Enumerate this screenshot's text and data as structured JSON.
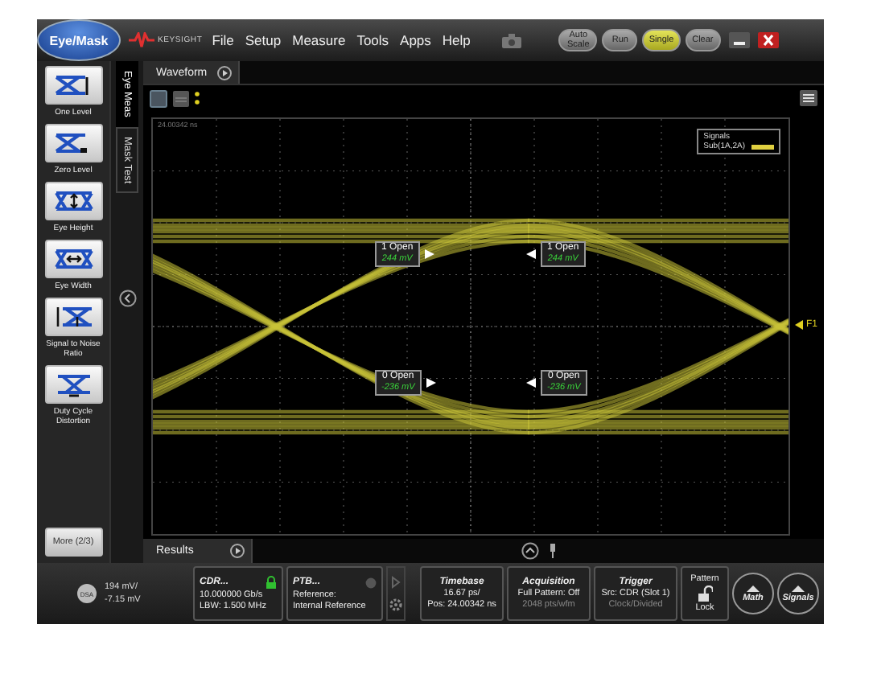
{
  "top_bar": {
    "mode_button": "Eye/Mask",
    "brand": "KEYSIGHT",
    "menu": [
      "File",
      "Setup",
      "Measure",
      "Tools",
      "Apps",
      "Help"
    ],
    "buttons": [
      {
        "label": "Auto Scale",
        "selected": false
      },
      {
        "label": "Run",
        "selected": false
      },
      {
        "label": "Single",
        "selected": true
      },
      {
        "label": "Clear",
        "selected": false
      }
    ]
  },
  "measurements": [
    {
      "label": "One Level",
      "kind": "one-level"
    },
    {
      "label": "Zero Level",
      "kind": "zero-level"
    },
    {
      "label": "Eye Height",
      "kind": "eye-height"
    },
    {
      "label": "Eye Width",
      "kind": "eye-width"
    },
    {
      "label": "Signal to Noise Ratio",
      "kind": "snr"
    },
    {
      "label": "Duty Cycle Distortion",
      "kind": "dcd"
    }
  ],
  "more_button": "More (2/3)",
  "side_tabs": [
    {
      "label": "Eye Meas",
      "selected": true
    },
    {
      "label": "Mask Test",
      "selected": false
    }
  ],
  "waveform": {
    "tab": "Waveform",
    "timestamp": "24.00342 ns",
    "legend": {
      "title": "Signals",
      "item": "Sub(1A,2A)"
    },
    "marker_label": "F1",
    "markers": [
      {
        "title": "1 Open",
        "value": "244 mV"
      },
      {
        "title": "1 Open",
        "value": "244 mV"
      },
      {
        "title": "0 Open",
        "value": "-236 mV"
      },
      {
        "title": "0 Open",
        "value": "-236 mV"
      }
    ]
  },
  "results_tab": "Results",
  "status_bar": {
    "channel": {
      "badge": "DSA",
      "scale": "194 mV/",
      "offset": "-7.15 mV"
    },
    "cdr": {
      "title": "CDR...",
      "rate": "10.000000 Gb/s",
      "lbw": "LBW: 1.500 MHz",
      "locked": true
    },
    "ptb": {
      "title": "PTB...",
      "label": "Reference:",
      "value": "Internal Reference"
    },
    "panels": [
      {
        "title": "Timebase",
        "lines": [
          {
            "text": "16.67 ps/",
            "dim": false
          },
          {
            "text": "Pos: 24.00342 ns",
            "dim": false
          }
        ]
      },
      {
        "title": "Acquisition",
        "lines": [
          {
            "text": "Full Pattern: Off",
            "dim": false
          },
          {
            "text": "2048 pts/wfm",
            "dim": true
          }
        ]
      },
      {
        "title": "Trigger",
        "lines": [
          {
            "text": "Src: CDR (Slot 1)",
            "dim": false
          },
          {
            "text": "Clock/Divided",
            "dim": true
          }
        ]
      }
    ],
    "pattern": {
      "title": "Pattern",
      "label": "Lock",
      "locked": false
    },
    "round_buttons": [
      "Math",
      "Signals"
    ]
  }
}
